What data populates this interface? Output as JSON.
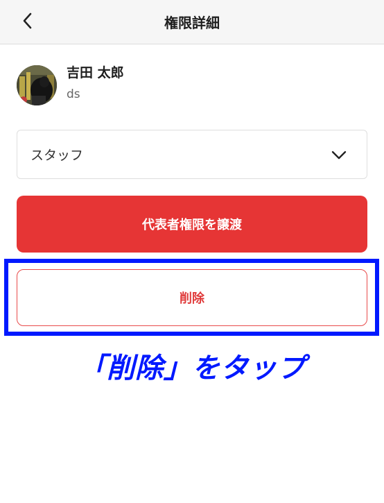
{
  "header": {
    "title": "権限詳細",
    "back_icon": "chevron-left-icon"
  },
  "user": {
    "name": "吉田 太郎",
    "sub": "ds"
  },
  "role_select": {
    "value": "スタッフ",
    "icon": "chevron-down-icon"
  },
  "actions": {
    "transfer_label": "代表者権限を譲渡",
    "delete_label": "削除"
  },
  "annotation": {
    "text": "「削除」をタップ"
  },
  "colors": {
    "accent_red": "#e63535",
    "annotation_blue": "#0019ff"
  }
}
